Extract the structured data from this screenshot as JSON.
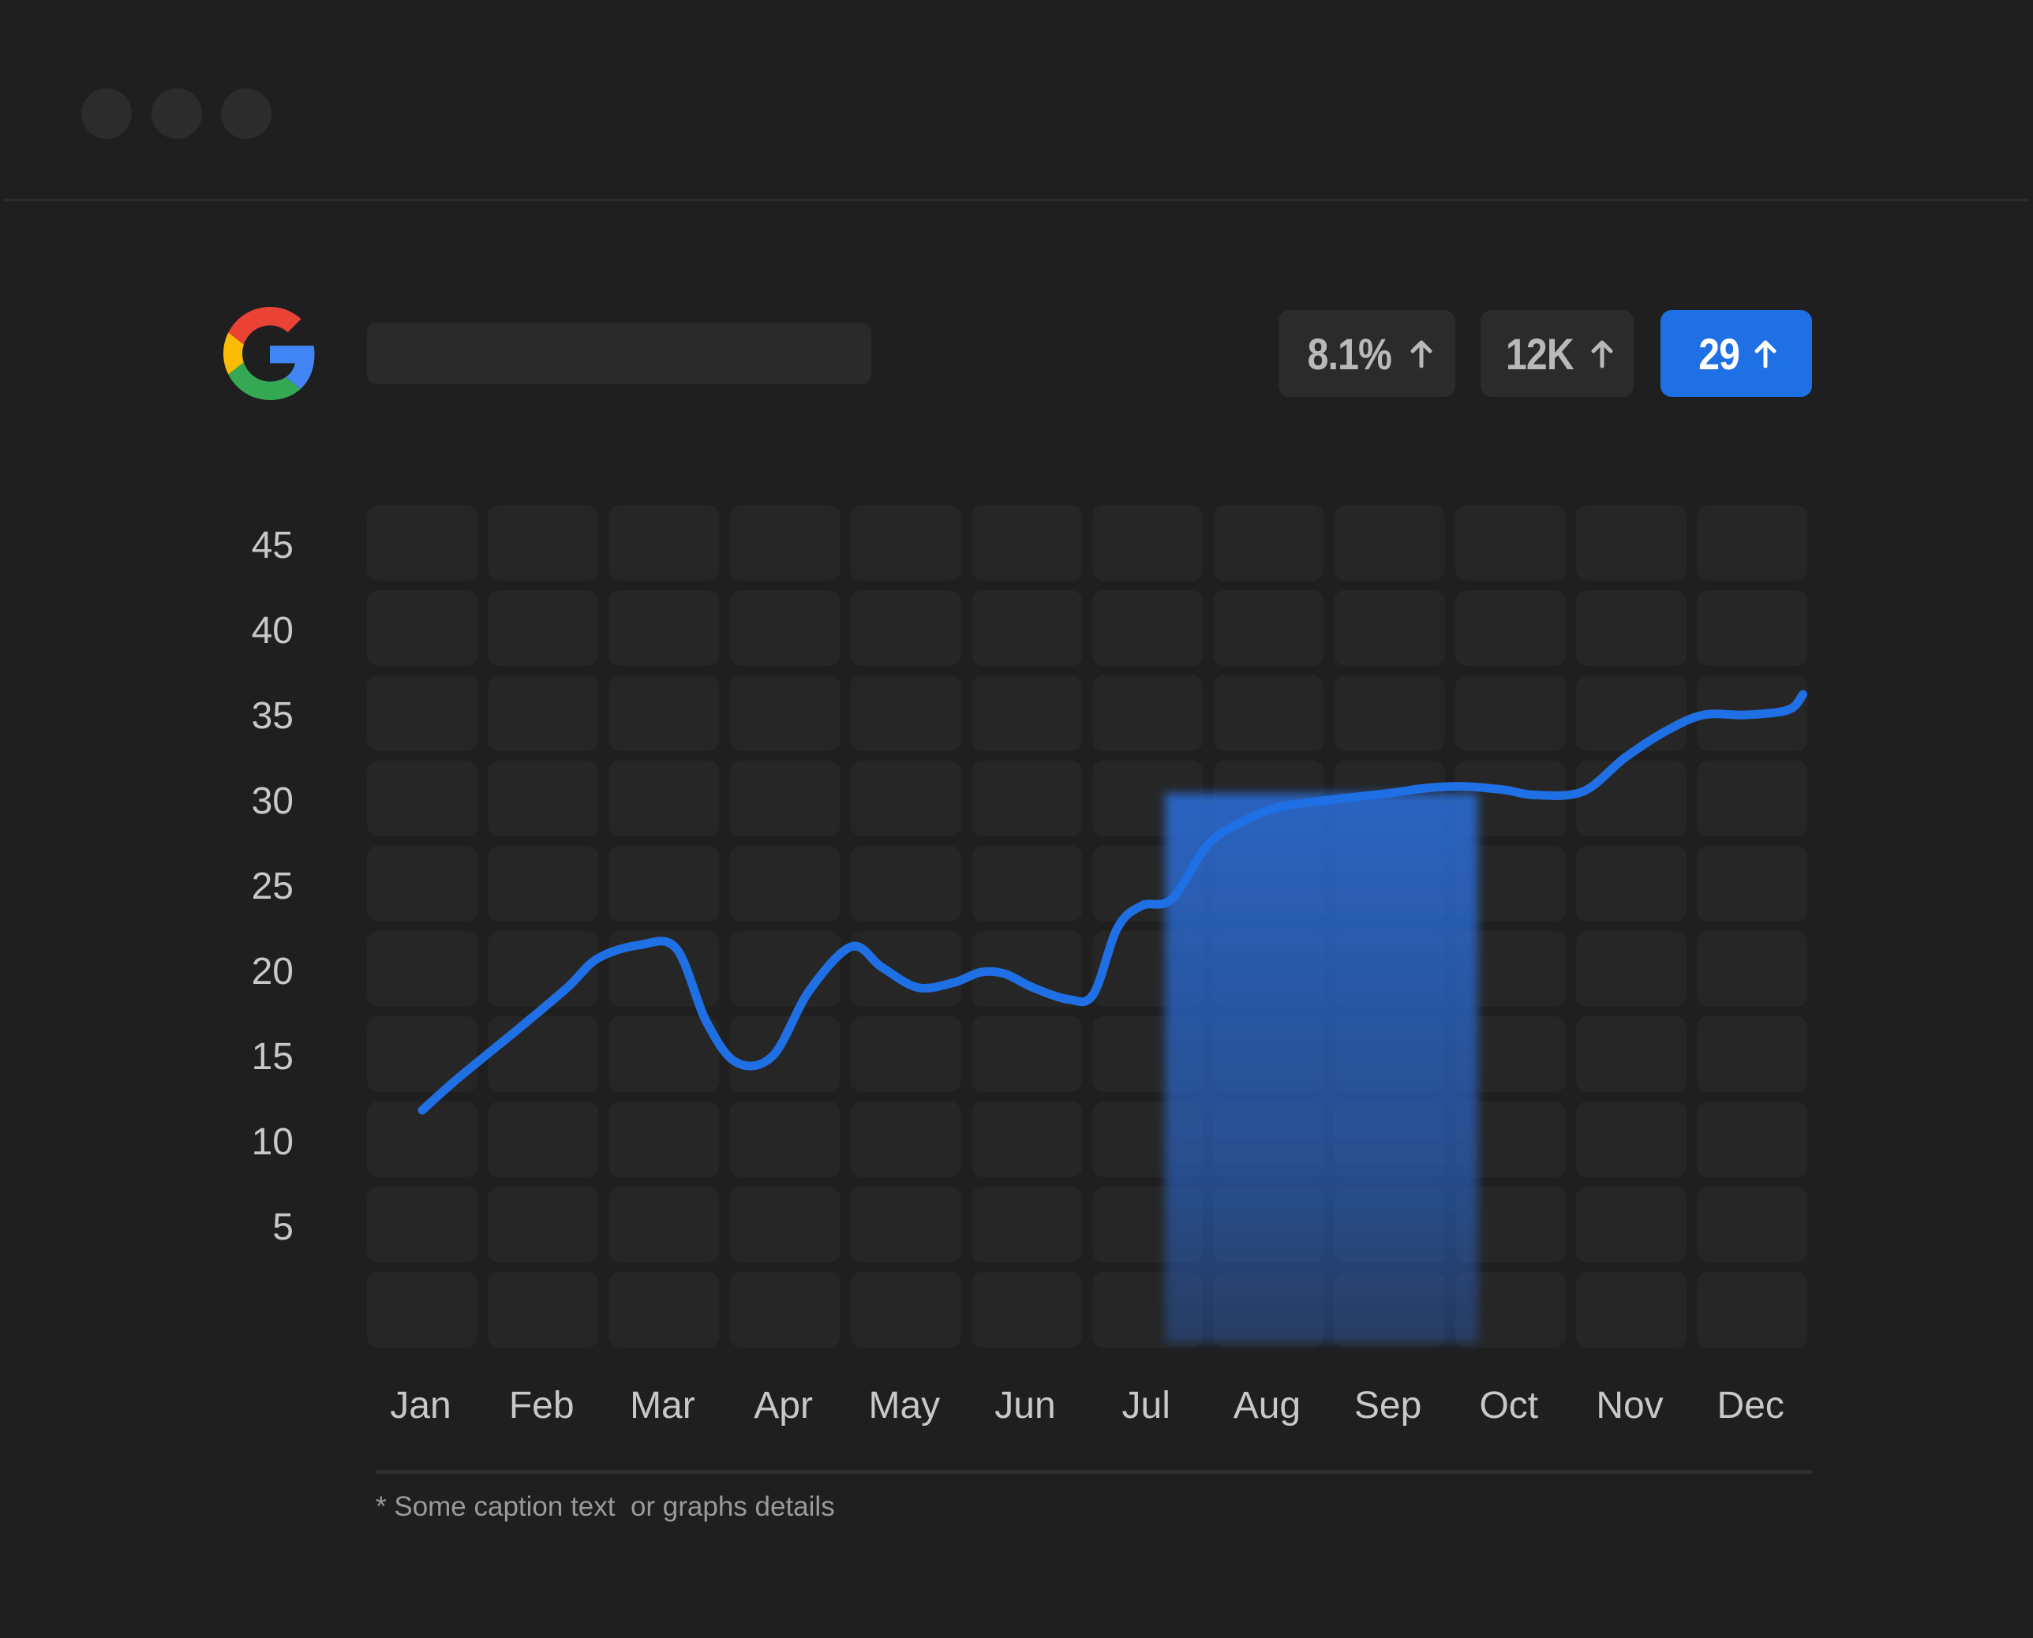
{
  "window": {
    "controls": [
      "window-dot",
      "window-dot",
      "window-dot"
    ]
  },
  "header": {
    "logo_icon": "google-g-icon",
    "badges": [
      {
        "value": "8.1%",
        "icon": "arrow-up-icon",
        "active": false
      },
      {
        "value": "12K",
        "icon": "arrow-up-icon",
        "active": false
      },
      {
        "value": "29",
        "icon": "arrow-up-icon",
        "active": true
      }
    ]
  },
  "colors": {
    "background": "#1f1f1f",
    "cell": "#262626",
    "accent": "#1f6fe5",
    "badge": "#2b2b2b",
    "text": "#c8c8c8"
  },
  "chart_data": {
    "type": "line",
    "categories": [
      "Jan",
      "Feb",
      "Mar",
      "Apr",
      "May",
      "Jun",
      "Jul",
      "Aug",
      "Sep",
      "Oct",
      "Nov",
      "Dec"
    ],
    "y_ticks": [
      5,
      10,
      15,
      20,
      25,
      30,
      35,
      40,
      45
    ],
    "ylim": [
      0,
      50
    ],
    "grid": true,
    "series": [
      {
        "x": [
          0,
          0.3,
          0.8,
          1.2,
          1.45,
          1.8,
          2.1,
          2.35,
          2.6,
          2.9,
          3.2,
          3.55,
          3.8,
          4.1,
          4.4,
          4.62,
          4.82,
          5.05,
          5.35,
          5.55,
          5.75,
          5.95,
          6.2,
          6.5,
          6.8,
          7.1,
          7.5,
          8.0,
          8.3,
          8.6,
          8.95,
          9.2,
          9.6,
          9.95,
          10.3,
          10.6,
          10.95,
          11.3,
          11.42
        ],
        "y": [
          11.8,
          13.7,
          16.6,
          19.0,
          20.7,
          21.5,
          21.3,
          17.0,
          14.6,
          15.0,
          18.8,
          21.4,
          20.2,
          19.0,
          19.3,
          19.9,
          19.8,
          19.0,
          18.3,
          18.6,
          22.5,
          23.8,
          24.2,
          27.4,
          28.8,
          29.6,
          30.0,
          30.4,
          30.7,
          30.8,
          30.6,
          30.3,
          30.5,
          32.5,
          34.1,
          35.0,
          35.0,
          35.3,
          36.2
        ]
      }
    ],
    "highlight_range": [
      "Jul",
      "Sep"
    ]
  },
  "caption": "* Some caption text  or graphs details"
}
